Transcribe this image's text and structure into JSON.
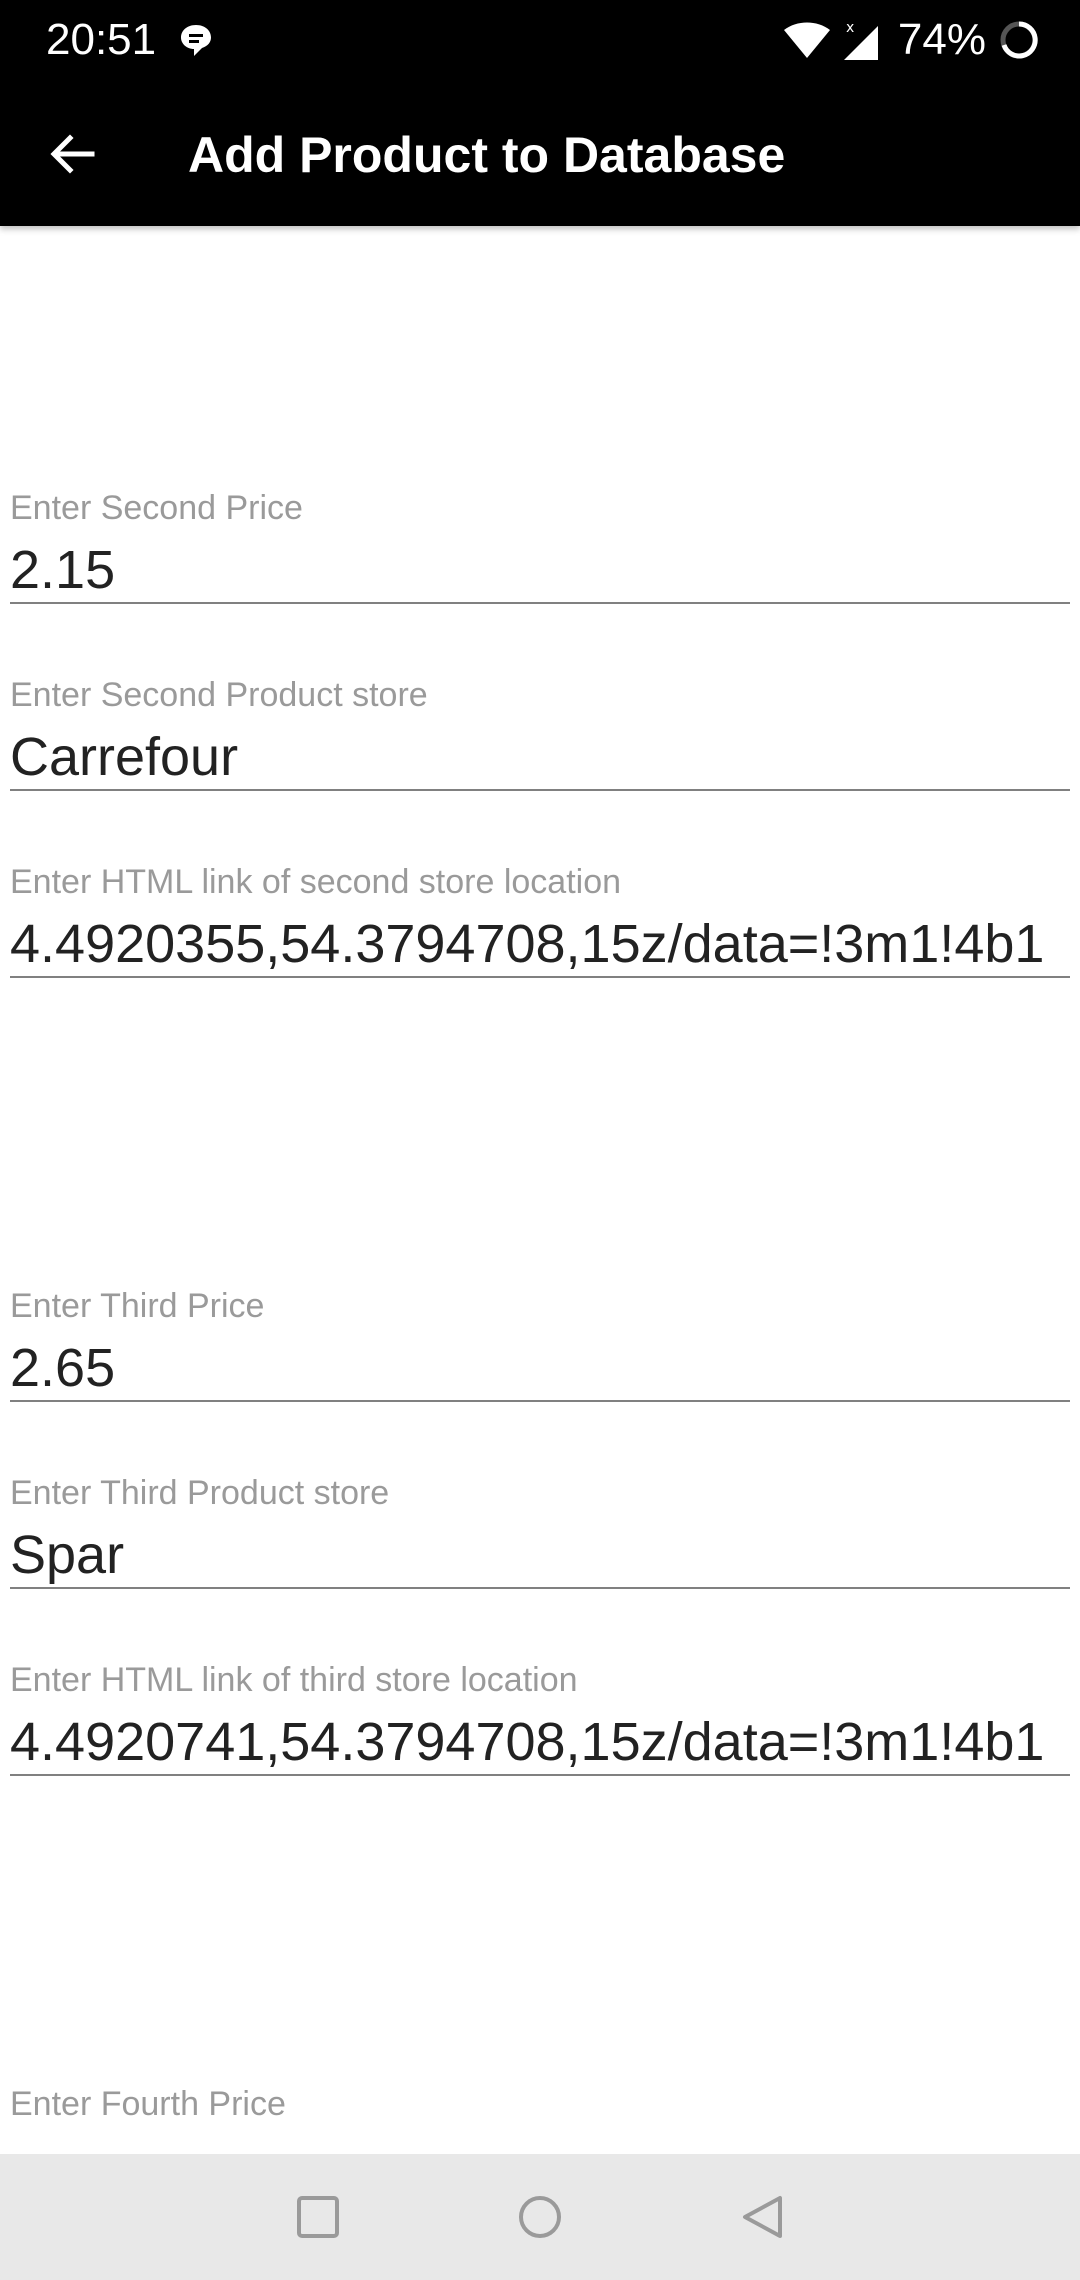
{
  "status_bar": {
    "time": "20:51",
    "battery": "74%",
    "icons": [
      "message-icon",
      "wifi-icon",
      "signal-icon",
      "battery-ring-icon"
    ]
  },
  "app_bar": {
    "title": "Add Product to Database",
    "back_icon": "arrow-left-icon"
  },
  "fields": {
    "second_price": {
      "label": "Enter Second Price",
      "value": "2.15"
    },
    "second_store": {
      "label": "Enter Second Product store",
      "value": "Carrefour"
    },
    "second_link": {
      "label": "Enter HTML link of second store location",
      "value": "4.4920355,54.3794708,15z/data=!3m1!4b1"
    },
    "third_price": {
      "label": "Enter Third Price",
      "value": "2.65"
    },
    "third_store": {
      "label": "Enter Third Product store",
      "value": "Spar"
    },
    "third_link": {
      "label": "Enter HTML link of third store location",
      "value": "4.4920741,54.3794708,15z/data=!3m1!4b1"
    },
    "fourth_price": {
      "label": "Enter Fourth Price"
    }
  },
  "nav_bar": {
    "icons": [
      "recents-square-icon",
      "home-circle-icon",
      "back-triangle-icon"
    ]
  }
}
